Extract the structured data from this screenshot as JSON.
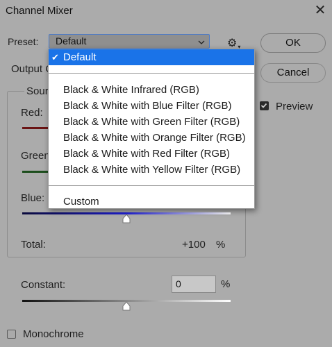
{
  "window": {
    "title": "Channel Mixer"
  },
  "preset": {
    "label": "Preset:",
    "value": "Default"
  },
  "buttons": {
    "ok": "OK",
    "cancel": "Cancel"
  },
  "preview": {
    "label": "Preview",
    "checked": true
  },
  "output_channel": {
    "label_visible": "Output C"
  },
  "source_group": {
    "label_visible": "Sour",
    "channels": [
      {
        "label_visible": "Red:"
      },
      {
        "label_visible": "Green"
      },
      {
        "label_visible": "Blue:"
      }
    ],
    "total": {
      "label": "Total:",
      "value": "+100",
      "unit": "%"
    }
  },
  "constant": {
    "label": "Constant:",
    "value": "0",
    "unit": "%",
    "slider_level": 0.5
  },
  "monochrome": {
    "label": "Monochrome",
    "checked": false
  },
  "preset_menu": {
    "selected": "Default",
    "items_group1": [
      "Default"
    ],
    "items_group2": [
      "Black & White Infrared (RGB)",
      "Black & White with Blue Filter (RGB)",
      "Black & White with Green Filter (RGB)",
      "Black & White with Orange Filter (RGB)",
      "Black & White with Red Filter (RGB)",
      "Black & White with Yellow Filter (RGB)"
    ],
    "items_group3": [
      "Custom"
    ]
  },
  "colors": {
    "accent": "#1a73e8",
    "blue_slider": "#2222cc"
  }
}
